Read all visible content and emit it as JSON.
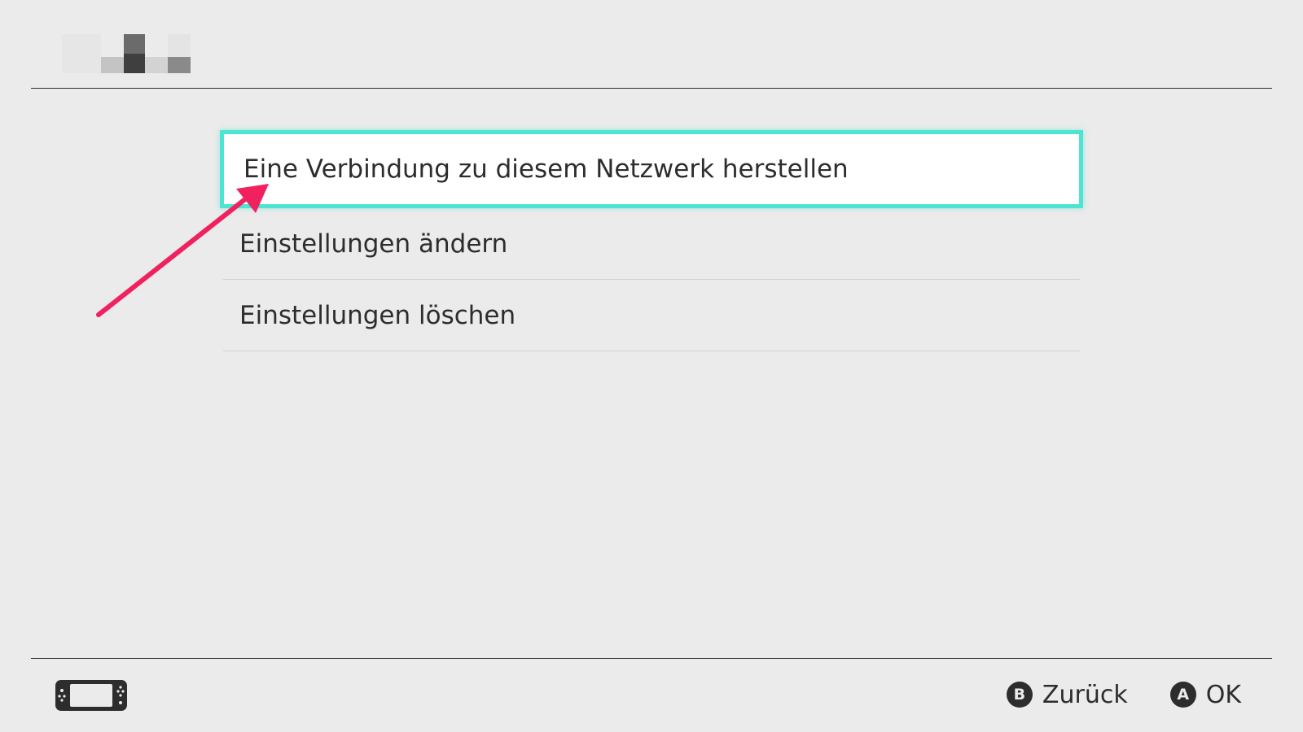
{
  "header": {
    "title_logo": "pixelated-logo"
  },
  "menu": {
    "items": [
      {
        "label": "Eine Verbindung zu diesem Netzwerk herstellen",
        "selected": true
      },
      {
        "label": "Einstellungen ändern",
        "selected": false
      },
      {
        "label": "Einstellungen löschen",
        "selected": false
      }
    ]
  },
  "annotation": {
    "arrow_color": "#f0215e"
  },
  "footer": {
    "console_icon": "handheld-console-icon",
    "actions": [
      {
        "glyph": "B",
        "label": "Zurück"
      },
      {
        "glyph": "A",
        "label": "OK"
      }
    ]
  },
  "colors": {
    "background": "#ebebeb",
    "selection_border": "#4de4d1",
    "text": "#2d2d2d"
  }
}
